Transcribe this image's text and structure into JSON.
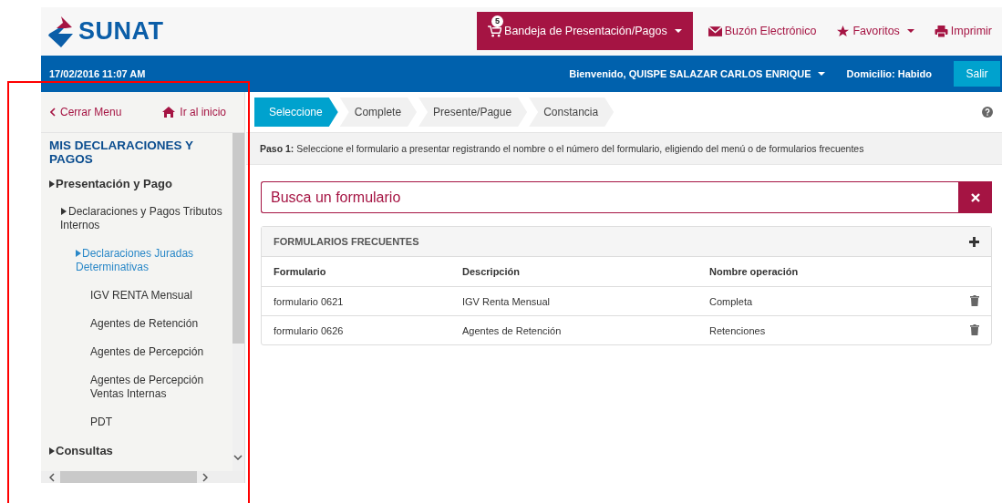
{
  "header": {
    "logo_text": "SUNAT",
    "nav": [
      {
        "kind": "tray",
        "label": "Bandeja de Presentación/Pagos",
        "badge": "5",
        "dropdown": true
      },
      {
        "kind": "mail",
        "label": "Buzón Electrónico",
        "dropdown": false
      },
      {
        "kind": "star",
        "label": "Favoritos",
        "dropdown": true
      },
      {
        "kind": "print",
        "label": "Imprimir",
        "dropdown": false
      }
    ]
  },
  "user_bar": {
    "datetime": "17/02/2016 11:07 AM",
    "welcome": "Bienvenido, QUISPE SALAZAR CARLOS ENRIQUE",
    "domicilio": "Domicilio: Habido",
    "logout": "Salir"
  },
  "sidebar": {
    "close_menu": "Cerrar Menu",
    "home": "Ir al inicio",
    "title": "MIS DECLARACIONES Y PAGOS",
    "items": [
      {
        "label": "Presentación y Pago",
        "expandable": true,
        "selected": false,
        "children": [
          {
            "label": "Declaraciones y Pagos Tributos Internos",
            "expandable": true,
            "selected": false,
            "children": [
              {
                "label": "Declaraciones Juradas Determinativas",
                "expandable": true,
                "selected": true,
                "children": [
                  {
                    "label": "IGV RENTA Mensual",
                    "expandable": false,
                    "selected": false
                  },
                  {
                    "label": "Agentes de Retención",
                    "expandable": false,
                    "selected": false
                  },
                  {
                    "label": "Agentes de Percepción",
                    "expandable": false,
                    "selected": false
                  },
                  {
                    "label": "Agentes de Percepción Ventas Internas",
                    "expandable": false,
                    "selected": false
                  },
                  {
                    "label": "PDT",
                    "expandable": false,
                    "selected": false
                  }
                ]
              }
            ]
          }
        ]
      },
      {
        "label": "Consultas",
        "expandable": true,
        "selected": false
      }
    ]
  },
  "steps": [
    {
      "label": "Seleccione",
      "selected": true
    },
    {
      "label": "Complete",
      "selected": false
    },
    {
      "label": "Presente/Pague",
      "selected": false
    },
    {
      "label": "Constancia",
      "selected": false
    }
  ],
  "instruction": "**Paso 1:** Seleccione el formulario a presentar registrando el nombre o el número del formulario, eligiendo del menú o de formularios frecuentes",
  "search": {
    "placeholder": "Busca un formulario"
  },
  "frequent_forms": {
    "title": "FORMULARIOS FRECUENTES",
    "columns": [
      "Formulario",
      "Descripción",
      "Nombre operación"
    ],
    "rows": [
      [
        "formulario 0621",
        "IGV Renta Mensual",
        "Completa"
      ],
      [
        "formulario 0626",
        "Agentes de Retención",
        "Retenciones"
      ]
    ]
  }
}
